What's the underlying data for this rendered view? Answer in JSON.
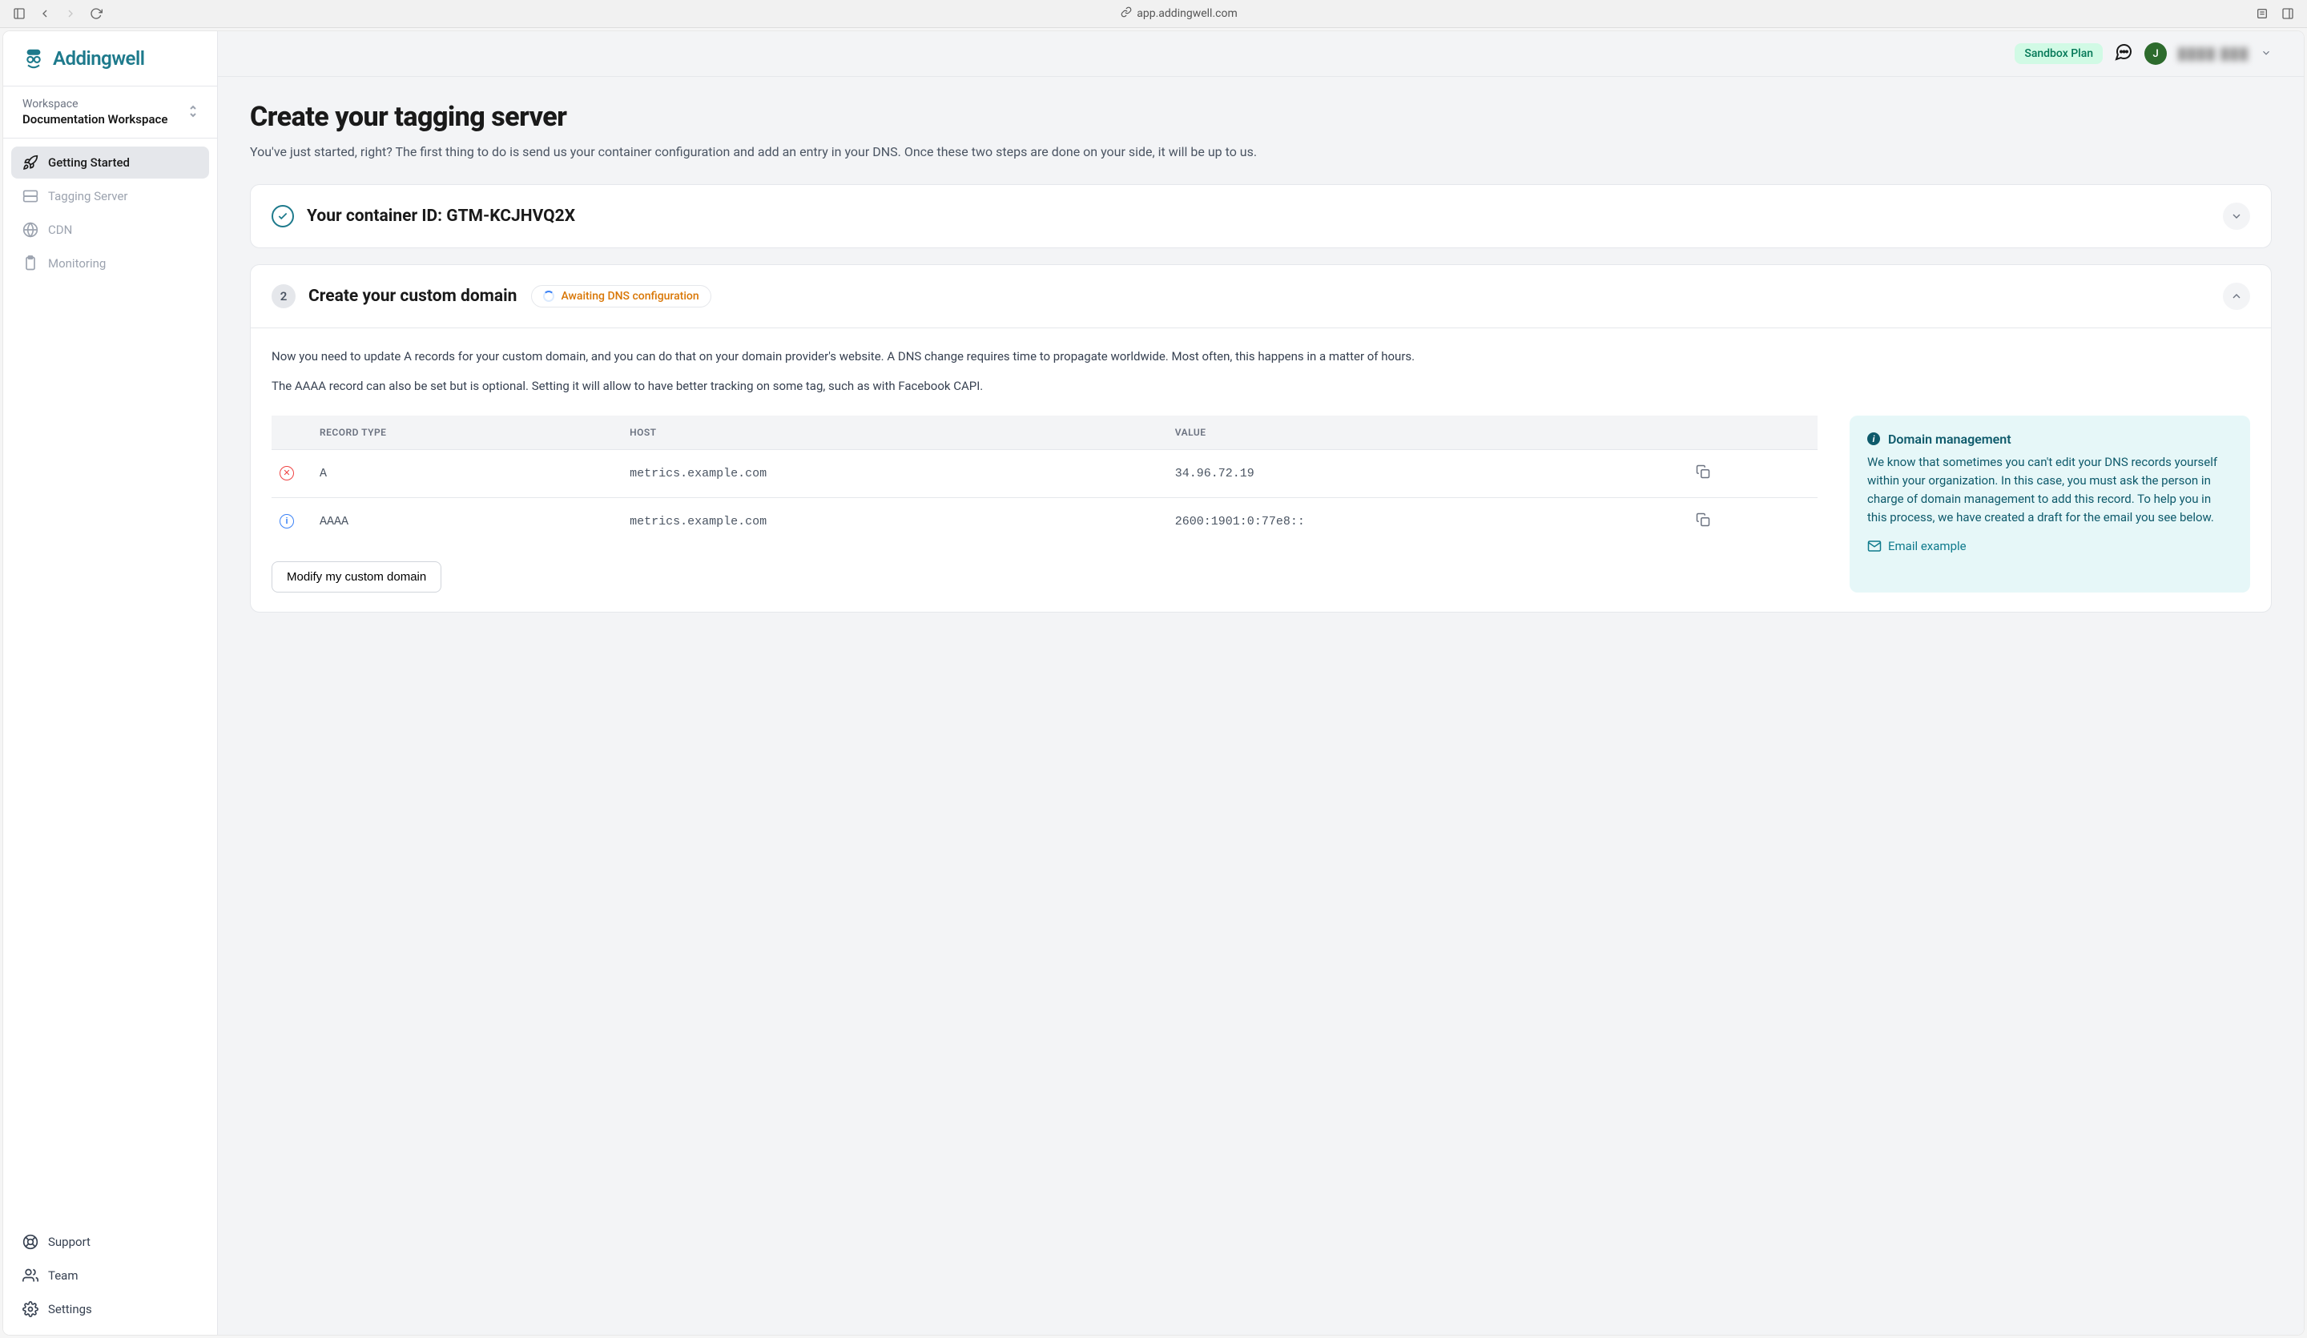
{
  "browser": {
    "url": "app.addingwell.com"
  },
  "brand": {
    "name": "Addingwell"
  },
  "workspace": {
    "label": "Workspace",
    "name": "Documentation Workspace"
  },
  "nav": {
    "items": [
      {
        "label": "Getting Started"
      },
      {
        "label": "Tagging Server"
      },
      {
        "label": "CDN"
      },
      {
        "label": "Monitoring"
      }
    ],
    "bottom": [
      {
        "label": "Support"
      },
      {
        "label": "Team"
      },
      {
        "label": "Settings"
      }
    ]
  },
  "topbar": {
    "plan_badge": "Sandbox Plan",
    "avatar_initial": "J"
  },
  "page": {
    "title": "Create your tagging server",
    "subtitle": "You've just started, right? The first thing to do is send us your container configuration and add an entry in your DNS. Once these two steps are done on your side, it will be up to us."
  },
  "step1": {
    "title": "Your container ID: GTM-KCJHVQ2X"
  },
  "step2": {
    "number": "2",
    "title": "Create your custom domain",
    "status": "Awaiting DNS configuration",
    "body_text1": "Now you need to update A records for your custom domain, and you can do that on your domain provider's website. A DNS change requires time to propagate worldwide. Most often, this happens in a matter of hours.",
    "body_text2": "The AAAA record can also be set but is optional. Setting it will allow to have better tracking on some tag, such as with Facebook CAPI.",
    "table": {
      "headers": {
        "type": "RECORD TYPE",
        "host": "HOST",
        "value": "VALUE"
      },
      "rows": [
        {
          "type": "A",
          "host": "metrics.example.com",
          "value": "34.96.72.19"
        },
        {
          "type": "AAAA",
          "host": "metrics.example.com",
          "value": "2600:1901:0:77e8::"
        }
      ]
    },
    "info": {
      "title": "Domain management",
      "text": "We know that sometimes you can't edit your DNS records yourself within your organization. In this case, you must ask the person in charge of domain management to add this record. To help you in this process, we have created a draft for the email you see below.",
      "link": "Email example"
    },
    "modify_button": "Modify my custom domain"
  }
}
